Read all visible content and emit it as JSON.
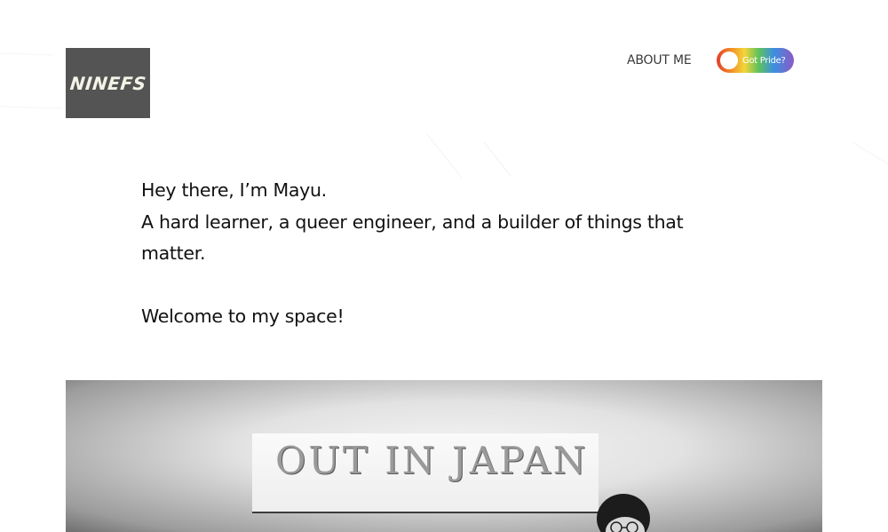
{
  "header": {
    "logo_text": "NINEFS",
    "nav": {
      "about_label": "ABOUT ME"
    },
    "pride_toggle": {
      "label": "Got Pride?",
      "state": "off"
    }
  },
  "intro": {
    "line1": "Hey there, I’m Mayu.",
    "line2": "A hard learner, a queer engineer, and a builder of things that matter.",
    "line3": "Welcome to my space!"
  },
  "hero": {
    "sign_text": "OUT IN JAPAN"
  },
  "colors": {
    "logo_bg": "#545454",
    "logo_text": "#f3f3e6",
    "text": "#111111",
    "nav_text": "#3a3a3a"
  }
}
